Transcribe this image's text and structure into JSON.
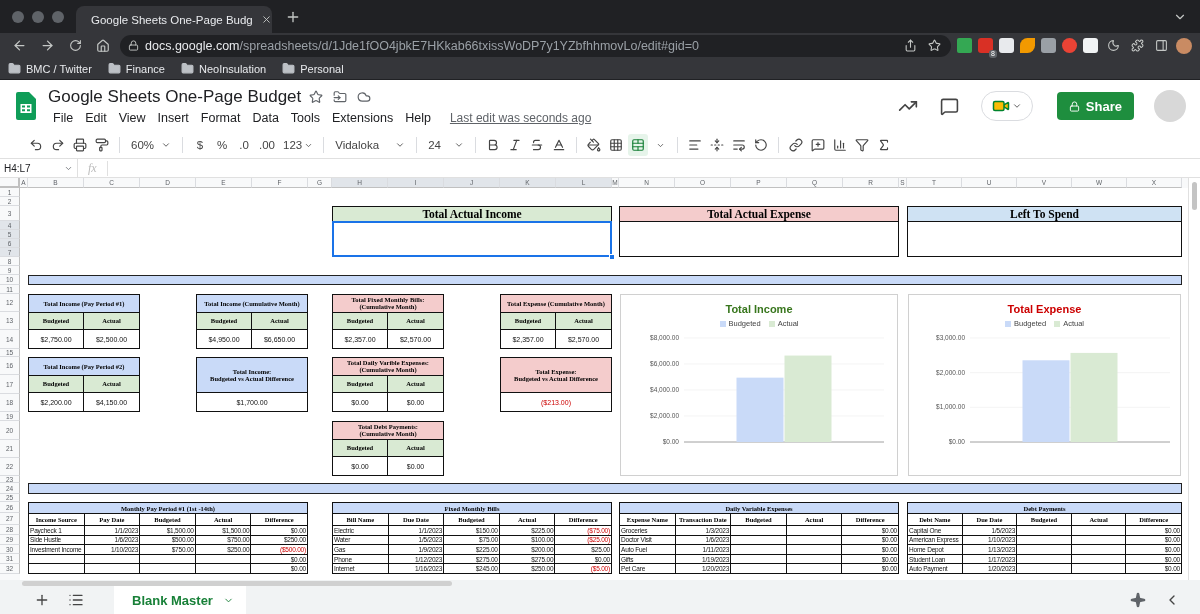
{
  "browser": {
    "tab_title": "Google Sheets One-Page Budg",
    "url_host": "docs.google.com",
    "url_path": "/spreadsheets/d/1Jde1fOO4jbkE7HKkab66txissWoDP7y1YZbfhhmovLo/edit#gid=0",
    "extension_badge": "8",
    "bookmarks": [
      "BMC / Twitter",
      "Finance",
      "NeoInsulation",
      "Personal"
    ]
  },
  "app": {
    "title": "Google Sheets One-Page Budget",
    "menu": [
      "File",
      "Edit",
      "View",
      "Insert",
      "Format",
      "Data",
      "Tools",
      "Extensions",
      "Help"
    ],
    "last_edit": "Last edit was seconds ago",
    "share": "Share"
  },
  "toolbar": {
    "zoom": "60%",
    "currency": "$",
    "percent": "%",
    "decrease_decimal": ".0",
    "increase_decimal": ".00",
    "number_format": "123",
    "font": "Vidaloka",
    "font_size": "24",
    "merge_active": true
  },
  "formula_bar": {
    "name_box": "H4:L7",
    "fx": "fx"
  },
  "columns": [
    {
      "label": "A",
      "selected": false
    },
    {
      "label": "B",
      "selected": false
    },
    {
      "label": "C",
      "selected": false
    },
    {
      "label": "D",
      "selected": false
    },
    {
      "label": "E",
      "selected": false
    },
    {
      "label": "F",
      "selected": false
    },
    {
      "label": "G",
      "selected": false
    },
    {
      "label": "H",
      "selected": true
    },
    {
      "label": "I",
      "selected": true
    },
    {
      "label": "J",
      "selected": true
    },
    {
      "label": "K",
      "selected": true
    },
    {
      "label": "L",
      "selected": true
    },
    {
      "label": "M",
      "selected": false
    },
    {
      "label": "N",
      "selected": false
    },
    {
      "label": "O",
      "selected": false
    },
    {
      "label": "P",
      "selected": false
    },
    {
      "label": "Q",
      "selected": false
    },
    {
      "label": "R",
      "selected": false
    },
    {
      "label": "S",
      "selected": false
    },
    {
      "label": "T",
      "selected": false
    },
    {
      "label": "U",
      "selected": false
    },
    {
      "label": "V",
      "selected": false
    },
    {
      "label": "W",
      "selected": false
    },
    {
      "label": "X",
      "selected": false
    }
  ],
  "rows": [
    {
      "label": "1",
      "selected": false
    },
    {
      "label": "2",
      "selected": false
    },
    {
      "label": "3",
      "selected": false
    },
    {
      "label": "4",
      "selected": true
    },
    {
      "label": "5",
      "selected": true
    },
    {
      "label": "6",
      "selected": true
    },
    {
      "label": "7",
      "selected": true
    },
    {
      "label": "8",
      "selected": false
    },
    {
      "label": "9",
      "selected": false
    },
    {
      "label": "10",
      "selected": false
    },
    {
      "label": "11",
      "selected": false
    },
    {
      "label": "12",
      "selected": false
    },
    {
      "label": "13",
      "selected": false
    },
    {
      "label": "14",
      "selected": false
    },
    {
      "label": "15",
      "selected": false
    },
    {
      "label": "16",
      "selected": false
    },
    {
      "label": "17",
      "selected": false
    },
    {
      "label": "18",
      "selected": false
    },
    {
      "label": "19",
      "selected": false
    },
    {
      "label": "20",
      "selected": false
    },
    {
      "label": "21",
      "selected": false
    },
    {
      "label": "22",
      "selected": false
    },
    {
      "label": "23",
      "selected": false
    },
    {
      "label": "24",
      "selected": false
    },
    {
      "label": "25",
      "selected": false
    },
    {
      "label": "26",
      "selected": false
    },
    {
      "label": "27",
      "selected": false
    },
    {
      "label": "28",
      "selected": false
    },
    {
      "label": "29",
      "selected": false
    },
    {
      "label": "30",
      "selected": false
    },
    {
      "label": "31",
      "selected": false
    },
    {
      "label": "32",
      "selected": false
    }
  ],
  "summary_cards": [
    {
      "title": "Total Actual Income",
      "color": "#d9ead3",
      "selected": true
    },
    {
      "title": "Total Actual Expense",
      "color": "#f4cccc",
      "selected": false
    },
    {
      "title": "Left To Spend",
      "color": "#cfe2f3",
      "selected": false
    }
  ],
  "summary_groups": [
    {
      "boxes": [
        {
          "kind": "pair",
          "title": "Total Income (Pay Period #1)",
          "color": "#c9daf8",
          "labels": [
            "Budgeted",
            "Actual"
          ],
          "values": [
            "$2,750.00",
            "$2,500.00"
          ]
        },
        {
          "kind": "pair",
          "title": "Total Income (Pay Period #2)",
          "color": "#c9daf8",
          "labels": [
            "Budgeted",
            "Actual"
          ],
          "values": [
            "$2,200.00",
            "$4,150.00"
          ]
        }
      ]
    },
    {
      "boxes": [
        {
          "kind": "pair",
          "title": "Total Income (Cumulative Month)",
          "color": "#c9daf8",
          "labels": [
            "Budgeted",
            "Actual"
          ],
          "values": [
            "$4,950.00",
            "$6,650.00"
          ]
        },
        {
          "kind": "difference",
          "title": "Total Income:\nBudgeted vs Actual Difference",
          "color": "#c9daf8",
          "value": "$1,700.00",
          "negative": false
        }
      ]
    },
    {
      "boxes": [
        {
          "kind": "pair",
          "title": "Total Fixed Monthly Bills:\n(Cumulative Month)",
          "color": "#f4cccc",
          "labels": [
            "Budgeted",
            "Actual"
          ],
          "values": [
            "$2,357.00",
            "$2,570.00"
          ]
        },
        {
          "kind": "pair",
          "title": "Total Daily Varible Expenses:\n(Cumulative Month)",
          "color": "#f4cccc",
          "labels": [
            "Budgeted",
            "Actual"
          ],
          "values": [
            "$0.00",
            "$0.00"
          ]
        },
        {
          "kind": "pair",
          "title": "Total Debt Payments:\n(Cumulative Month)",
          "color": "#f4cccc",
          "labels": [
            "Budgeted",
            "Actual"
          ],
          "values": [
            "$0.00",
            "$0.00"
          ]
        }
      ]
    },
    {
      "boxes": [
        {
          "kind": "pair",
          "title": "Total Expense (Cumulative Month)",
          "color": "#f4cccc",
          "labels": [
            "Budgeted",
            "Actual"
          ],
          "values": [
            "$2,357.00",
            "$2,570.00"
          ]
        },
        {
          "kind": "difference",
          "title": "Total Expense:\nBudgeted vs Actual Difference",
          "color": "#f4cccc",
          "value": "($213.00)",
          "negative": true
        }
      ]
    }
  ],
  "charts": [
    {
      "color": "#38761d",
      "chart_data": {
        "type": "bar",
        "title": "Total Income",
        "grid": true,
        "legend": true,
        "series": [
          {
            "name": "Budgeted",
            "color": "#c9daf8",
            "values": [
              4950
            ]
          },
          {
            "name": "Actual",
            "color": "#d9ead3",
            "values": [
              6650
            ]
          }
        ],
        "ylim": [
          0,
          8000
        ],
        "yticks": [
          {
            "value": 0,
            "label": "$0.00"
          },
          {
            "value": 2000,
            "label": "$2,000.00"
          },
          {
            "value": 4000,
            "label": "$4,000.00"
          },
          {
            "value": 6000,
            "label": "$6,000.00"
          },
          {
            "value": 8000,
            "label": "$8,000.00"
          }
        ]
      }
    },
    {
      "color": "#cc0000",
      "chart_data": {
        "type": "bar",
        "title": "Total Expense",
        "grid": true,
        "legend": true,
        "series": [
          {
            "name": "Budgeted",
            "color": "#c9daf8",
            "values": [
              2357
            ]
          },
          {
            "name": "Actual",
            "color": "#d9ead3",
            "values": [
              2570
            ]
          }
        ],
        "ylim": [
          0,
          3000
        ],
        "yticks": [
          {
            "value": 0,
            "label": "$0.00"
          },
          {
            "value": 1000,
            "label": "$1,000.00"
          },
          {
            "value": 2000,
            "label": "$2,000.00"
          },
          {
            "value": 3000,
            "label": "$3,000.00"
          }
        ]
      }
    }
  ],
  "tables": [
    {
      "title": "Monthly Pay Period #1 (1st -14th)",
      "columns": [
        "Income Source",
        "Pay Date",
        "Budgeted",
        "Actual",
        "Difference"
      ],
      "rows": [
        {
          "cells": [
            "Paycheck 1",
            "1/1/2023",
            "$1,500.00",
            "$1,500.00",
            "$0.00"
          ],
          "negative": false
        },
        {
          "cells": [
            "Side Hustle",
            "1/6/2023",
            "$500.00",
            "$750.00",
            "$250.00"
          ],
          "negative": false
        },
        {
          "cells": [
            "Investment Income",
            "1/10/2023",
            "$750.00",
            "$250.00",
            "($500.00)"
          ],
          "negative": true
        },
        {
          "cells": [
            null,
            null,
            null,
            null,
            "$0.00"
          ],
          "negative": false
        },
        {
          "cells": [
            null,
            null,
            null,
            null,
            "$0.00"
          ],
          "negative": false
        }
      ]
    },
    {
      "title": "Fixed Monthly Bills",
      "columns": [
        "Bill Name",
        "Due Date",
        "Budgeted",
        "Actual",
        "Difference"
      ],
      "rows": [
        {
          "cells": [
            "Electric",
            "1/1/2023",
            "$150.00",
            "$225.00",
            "($75.00)"
          ],
          "negative": true
        },
        {
          "cells": [
            "Water",
            "1/5/2023",
            "$75.00",
            "$100.00",
            "($25.00)"
          ],
          "negative": true
        },
        {
          "cells": [
            "Gas",
            "1/9/2023",
            "$225.00",
            "$200.00",
            "$25.00"
          ],
          "negative": false
        },
        {
          "cells": [
            "Phone",
            "1/12/2023",
            "$275.00",
            "$275.00",
            "$0.00"
          ],
          "negative": false
        },
        {
          "cells": [
            "Internet",
            "1/16/2023",
            "$245.00",
            "$250.00",
            "($5.00)"
          ],
          "negative": true
        }
      ]
    },
    {
      "title": "Daily Variable Expenses",
      "columns": [
        "Expense Name",
        "Transaction Date",
        "Budgeted",
        "Actual",
        "Difference"
      ],
      "rows": [
        {
          "cells": [
            "Groceries",
            "1/3/2023",
            null,
            null,
            "$0.00"
          ],
          "negative": false
        },
        {
          "cells": [
            "Doctor Visit",
            "1/6/2023",
            null,
            null,
            "$0.00"
          ],
          "negative": false
        },
        {
          "cells": [
            "Auto Fuel",
            "1/11/2023",
            null,
            null,
            "$0.00"
          ],
          "negative": false
        },
        {
          "cells": [
            "Gifts",
            "1/19/2023",
            null,
            null,
            "$0.00"
          ],
          "negative": false
        },
        {
          "cells": [
            "Pet Care",
            "1/20/2023",
            null,
            null,
            "$0.00"
          ],
          "negative": false
        }
      ]
    },
    {
      "title": "Debt Payments",
      "columns": [
        "Debt Name",
        "Due Date",
        "Budgeted",
        "Actual",
        "Difference"
      ],
      "rows": [
        {
          "cells": [
            "Capital One",
            "1/5/2023",
            null,
            null,
            "$0.00"
          ],
          "negative": false
        },
        {
          "cells": [
            "American Express",
            "1/10/2023",
            null,
            null,
            "$0.00"
          ],
          "negative": false
        },
        {
          "cells": [
            "Home Depot",
            "1/13/2023",
            null,
            null,
            "$0.00"
          ],
          "negative": false
        },
        {
          "cells": [
            "Student Loan",
            "1/17/2023",
            null,
            null,
            "$0.00"
          ],
          "negative": false
        },
        {
          "cells": [
            "Auto Payment",
            "1/20/2023",
            null,
            null,
            "$0.00"
          ],
          "negative": false
        }
      ]
    }
  ],
  "sheet_tabs": [
    {
      "label": "Blank Master",
      "selected": true
    }
  ]
}
